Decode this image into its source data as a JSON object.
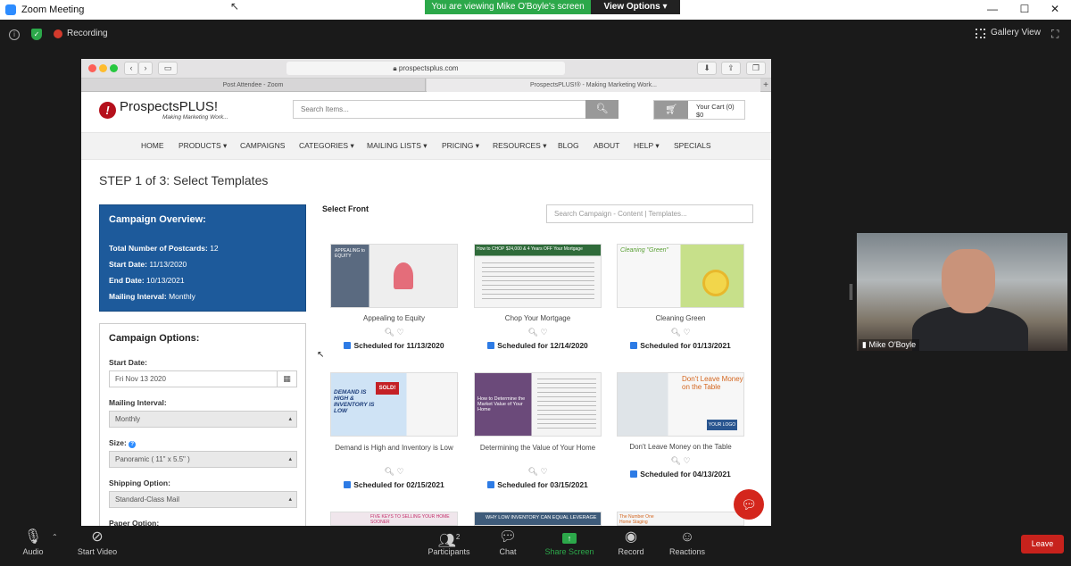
{
  "window": {
    "title": "Zoom Meeting"
  },
  "banner": {
    "viewing": "You are viewing Mike O'Boyle's screen",
    "view_options": "View Options"
  },
  "topbar": {
    "recording": "Recording",
    "gallery": "Gallery View"
  },
  "browser": {
    "url": "prospectsplus.com",
    "tabs": [
      "Post Attendee - Zoom",
      "ProspectsPLUS!® - Making Marketing Work..."
    ]
  },
  "site": {
    "brand": "ProspectsPLUS!",
    "tagline": "Making Marketing Work...",
    "search_placeholder": "Search Items...",
    "cart_label": "Your Cart (0)",
    "cart_total": "$0",
    "nav": [
      "HOME",
      "PRODUCTS ▾",
      "CAMPAIGNS",
      "CATEGORIES ▾",
      "MAILING LISTS ▾",
      "PRICING ▾",
      "RESOURCES ▾",
      "BLOG",
      "ABOUT",
      "HELP ▾",
      "SPECIALS"
    ]
  },
  "page": {
    "step_title": "STEP 1 of 3: Select Templates",
    "select_front": "Select Front",
    "template_search_placeholder": "Search Campaign - Content | Templates..."
  },
  "overview": {
    "title": "Campaign Overview:",
    "rows": [
      {
        "label": "Total Number of Postcards:",
        "value": "12"
      },
      {
        "label": "Start Date:",
        "value": "11/13/2020"
      },
      {
        "label": "End Date:",
        "value": "10/13/2021"
      },
      {
        "label": "Mailing Interval:",
        "value": "Monthly"
      }
    ]
  },
  "options": {
    "title": "Campaign Options:",
    "start_date_label": "Start Date:",
    "start_date_value": "Fri Nov 13 2020",
    "mailing_interval_label": "Mailing Interval:",
    "mailing_interval_value": "Monthly",
    "size_label": "Size:",
    "size_value": "Panoramic ( 11\" x 5.5\" )",
    "shipping_label": "Shipping Option:",
    "shipping_value": "Standard-Class Mail",
    "paper_label": "Paper Option:"
  },
  "templates": [
    {
      "title": "Appealing to Equity",
      "schedule": "Scheduled for 11/13/2020",
      "thumb_text": "APPEALING to EQUITY"
    },
    {
      "title": "Chop Your Mortgage",
      "schedule": "Scheduled for 12/14/2020",
      "thumb_text": "How to CHOP $24,000 & 4 Years OFF Your Mortgage"
    },
    {
      "title": "Cleaning Green",
      "schedule": "Scheduled for 01/13/2021",
      "thumb_text": "Cleaning \"Green\""
    },
    {
      "title": "Demand is High and Inventory is Low",
      "schedule": "Scheduled for 02/15/2021",
      "thumb_text": "DEMAND IS HIGH & INVENTORY IS LOW"
    },
    {
      "title": "Determining the Value of Your Home",
      "schedule": "Scheduled for 03/15/2021",
      "thumb_text": "How to Determine the Market Value of Your Home"
    },
    {
      "title": "Don't Leave Money on the Table",
      "schedule": "Scheduled for 04/13/2021",
      "thumb_text": "Don't Leave Money on the Table"
    }
  ],
  "partial_templates": [
    "FIVE KEYS TO SELLING YOUR HOME SOONER",
    "WHY LOW INVENTORY CAN EQUAL LEVERAGE",
    "The Number One Home Staging Mistake"
  ],
  "participant": {
    "name": "Mike O'Boyle"
  },
  "toolbar": {
    "audio": "Audio",
    "video": "Start Video",
    "participants": "Participants",
    "participants_count": "2",
    "chat": "Chat",
    "share": "Share Screen",
    "record": "Record",
    "reactions": "Reactions",
    "leave": "Leave"
  }
}
